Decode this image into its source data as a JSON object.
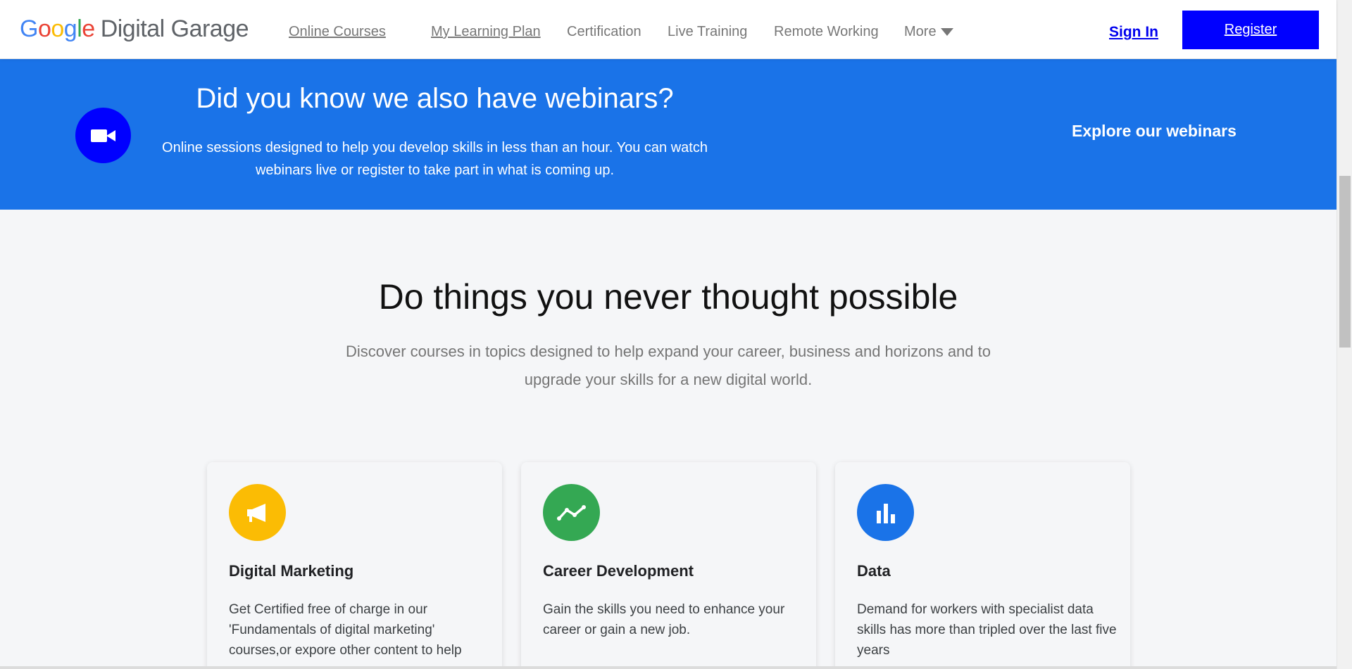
{
  "header": {
    "logo_google": [
      "G",
      "o",
      "o",
      "g",
      "l",
      "e"
    ],
    "logo_brand": "Digital Garage",
    "nav": [
      {
        "label": "Online Courses"
      },
      {
        "label": "My Learning Plan"
      },
      {
        "label": "Certification"
      },
      {
        "label": "Live Training"
      },
      {
        "label": "Remote Working"
      },
      {
        "label": "More"
      }
    ],
    "signin": "Sign In",
    "register": "Register"
  },
  "banner": {
    "icon": "video-camera-icon",
    "title": "Did you know we also have webinars?",
    "text": "Online sessions designed to help you develop skills in less than an hour. You can watch webinars live or register to take part in what is coming up.",
    "cta": "Explore our webinars",
    "color": "#1a73e8"
  },
  "main": {
    "title": "Do things you never thought possible",
    "subtitle": "Discover courses in topics designed to help expand your career, business and horizons and to upgrade your skills for a new digital world."
  },
  "cards": [
    {
      "icon": "megaphone-icon",
      "color": "#fbbc04",
      "title": "Digital Marketing",
      "text": "Get Certified free of charge in our 'Fundamentals of digital marketing' courses,or expore other content to help"
    },
    {
      "icon": "trend-line-icon",
      "color": "#34a853",
      "title": "Career Development",
      "text": "Gain the skills you need to enhance your career or gain a new job."
    },
    {
      "icon": "bar-chart-icon",
      "color": "#1a73e8",
      "title": "Data",
      "text": "Demand for workers with specialist data skills has more than tripled over the last five years"
    }
  ]
}
